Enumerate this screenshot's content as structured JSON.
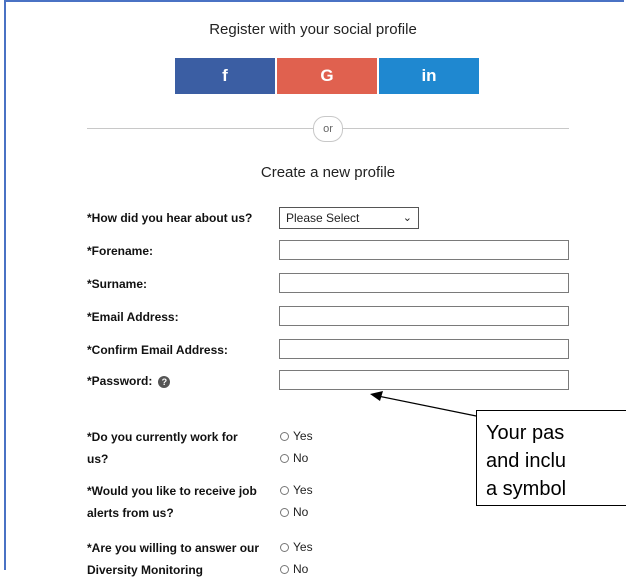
{
  "social": {
    "title": "Register with your social profile",
    "buttons": [
      {
        "label": "f",
        "color": "#3b5ea3"
      },
      {
        "label": "G",
        "color": "#e0614f"
      },
      {
        "label": "in",
        "color": "#1f88d0"
      }
    ]
  },
  "divider": {
    "or": "or"
  },
  "form": {
    "title": "Create a new profile",
    "hear_label": "*How did you hear about us?",
    "hear_select": "Please Select",
    "forename_label": "*Forename:",
    "surname_label": "*Surname:",
    "email_label": "*Email Address:",
    "confirm_email_label": "*Confirm Email Address:",
    "password_label": "*Password:",
    "work_label_1": "*Do you currently work for",
    "work_label_2": "us?",
    "alerts_label_1": "*Would you like to receive job",
    "alerts_label_2": "alerts from us?",
    "diversity_label_1": "*Are you willing to answer our",
    "diversity_label_2": "Diversity Monitoring",
    "yes": "Yes",
    "no": "No"
  },
  "callout": {
    "line1": "Your pas",
    "line2": "and inclu",
    "line3": "a symbol"
  }
}
